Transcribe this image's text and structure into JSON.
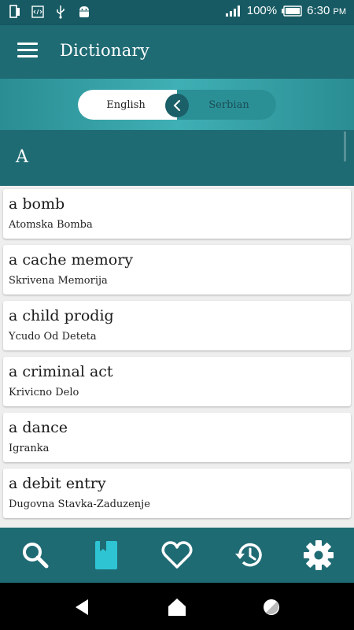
{
  "status_bar": {
    "battery": "100%",
    "time": "6:30",
    "ampm": "PM",
    "icons": [
      "phone-icon",
      "code-icon",
      "usb-icon",
      "android-icon",
      "signal-icon",
      "battery-icon"
    ]
  },
  "app_bar": {
    "title": "Dictionary",
    "menu_icon": "hamburger-menu-icon"
  },
  "language_switch": {
    "source": "English",
    "target": "Serbian",
    "swap_icon": "chevron-left-icon"
  },
  "section": {
    "letter": "A"
  },
  "entries": [
    {
      "term": "a bomb",
      "translation": "Atomska Bomba"
    },
    {
      "term": "a cache memory",
      "translation": "Skrivena Memorija"
    },
    {
      "term": "a child prodig",
      "translation": "Ycudo Od Deteta"
    },
    {
      "term": "a criminal act",
      "translation": "Krivicno Delo"
    },
    {
      "term": "a dance",
      "translation": "Igranka"
    },
    {
      "term": "a debit entry",
      "translation": "Dugovna Stavka-Zaduzenje"
    }
  ],
  "bottom_nav": {
    "items": [
      "search-icon",
      "book-icon",
      "heart-icon",
      "history-icon",
      "settings-icon"
    ],
    "active": "book-icon"
  },
  "colors": {
    "primary": "#1f6b74",
    "status_bar": "#175a63",
    "accent": "#2ec4d4",
    "gradient_mid": "#3fb0b5"
  }
}
